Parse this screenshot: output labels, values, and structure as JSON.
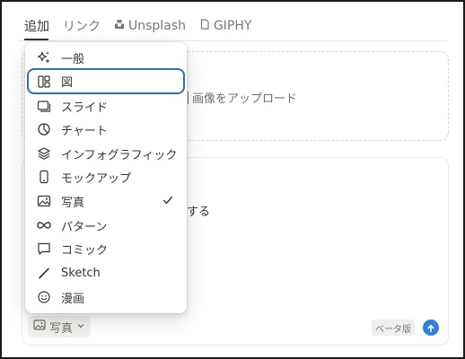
{
  "tabs": [
    {
      "label": "追加",
      "active": true
    },
    {
      "label": "リンク"
    },
    {
      "label": "Unsplash",
      "icon": "unsplash-icon"
    },
    {
      "label": "GIPHY",
      "icon": "document-icon"
    }
  ],
  "upload": {
    "label": "画像をアップロード"
  },
  "generate": {
    "prompt_text": "する"
  },
  "style_button": {
    "label": "写真"
  },
  "beta_badge": "ベータ版",
  "menu": {
    "items": [
      {
        "label": "一般",
        "icon": "sparkles-icon"
      },
      {
        "label": "図",
        "icon": "layout-icon",
        "selected": true
      },
      {
        "label": "スライド",
        "icon": "slides-icon"
      },
      {
        "label": "チャート",
        "icon": "pie-chart-icon"
      },
      {
        "label": "インフォグラフィック",
        "icon": "layers-icon"
      },
      {
        "label": "モックアップ",
        "icon": "phone-icon"
      },
      {
        "label": "写真",
        "icon": "image-icon",
        "checked": true
      },
      {
        "label": "パターン",
        "icon": "infinity-icon"
      },
      {
        "label": "コミック",
        "icon": "speech-bubble-icon"
      },
      {
        "label": "Sketch",
        "icon": "pencil-icon"
      },
      {
        "label": "漫画",
        "icon": "smiley-icon"
      }
    ]
  },
  "colors": {
    "accent": "#2f80dd",
    "selection_border": "#2f6fb7"
  }
}
